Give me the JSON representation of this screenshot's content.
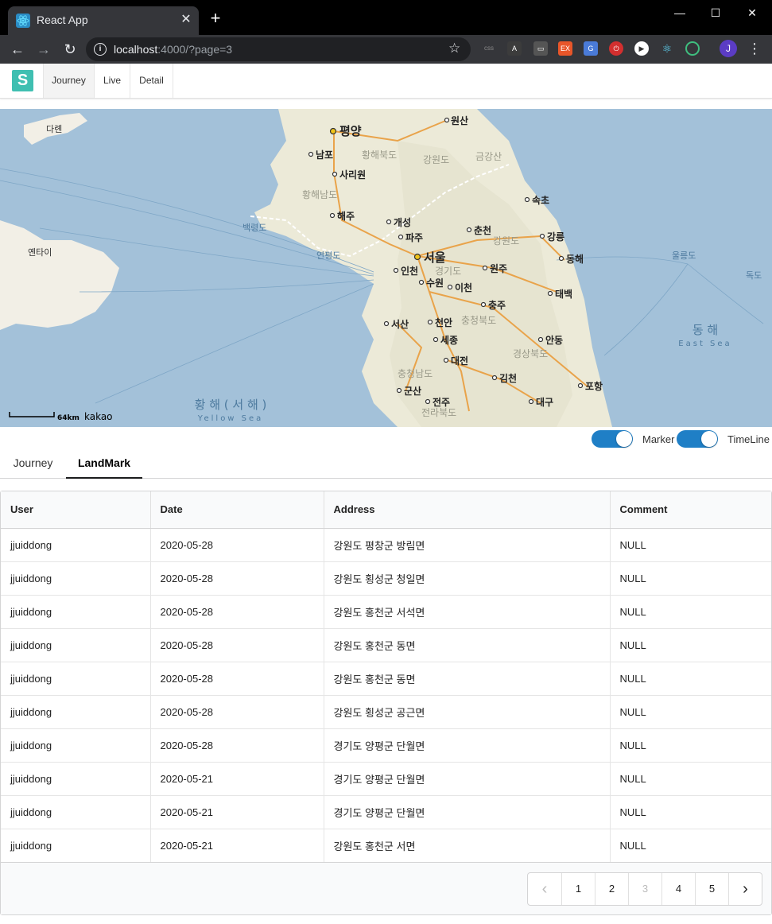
{
  "browser": {
    "tab_title": "React App",
    "tab_close": "✕",
    "new_tab": "+",
    "url_host": "localhost",
    "url_rest": ":4000/?page=3",
    "profile_initial": "J",
    "window_controls": [
      "—",
      "☐",
      "✕"
    ]
  },
  "app": {
    "logo": "S",
    "nav": [
      "Journey",
      "Live",
      "Detail"
    ],
    "active_nav": "Journey"
  },
  "map": {
    "scale_label": "64km",
    "provider": "kakao",
    "labels": {
      "pyongyang": "평양",
      "nampo": "남포",
      "sariwon": "사리원",
      "haeju": "해주",
      "kaesong": "개성",
      "paju": "파주",
      "seoul": "서울",
      "incheon": "인천",
      "suwon": "수원",
      "icheon": "이천",
      "chuncheon": "춘천",
      "wonju": "원주",
      "chungju": "충주",
      "cheonan": "천안",
      "sejong": "세종",
      "daejeon": "대전",
      "gimcheon": "김천",
      "daegu": "대구",
      "pohang": "포항",
      "andong": "안동",
      "gangneung": "강릉",
      "donghae": "동해",
      "sokcho": "속초",
      "taebaek": "태백",
      "seosan": "서산",
      "gunsan": "군산",
      "jeonju": "전주",
      "wonsan": "원산",
      "dalian": "다롄",
      "yantai": "옌타이",
      "yeonpyeongdo": "연평도",
      "baengnyeongdo": "백령도",
      "ulleungdo": "울릉도",
      "dokdo": "독도",
      "yellow_sea": "황 해 ( 서 해 )",
      "yellow_sea_en": "Yellow Sea",
      "east_sea": "동 해",
      "east_sea_en": "East Sea",
      "gangwon": "강원도",
      "gyeonggi": "경기도",
      "chungbuk": "충청북도",
      "chungnam": "충청남도",
      "gyeongbuk": "경상북도",
      "jeonbuk": "전라북도",
      "hwanghaebuk": "황해북도",
      "hwanghaenam": "황해남도",
      "gangwon_n": "강원도",
      "kumgangsan": "금강산"
    }
  },
  "toggles": [
    {
      "label": "Marker",
      "on": true
    },
    {
      "label": "TimeLine",
      "on": true
    }
  ],
  "tabs": [
    "Journey",
    "LandMark"
  ],
  "active_tab": "LandMark",
  "table": {
    "columns": [
      "User",
      "Date",
      "Address",
      "Comment"
    ],
    "rows": [
      [
        "jjuiddong",
        "2020-05-28",
        "강원도 평창군 방림면",
        "NULL"
      ],
      [
        "jjuiddong",
        "2020-05-28",
        "강원도 횡성군 청일면",
        "NULL"
      ],
      [
        "jjuiddong",
        "2020-05-28",
        "강원도 홍천군 서석면",
        "NULL"
      ],
      [
        "jjuiddong",
        "2020-05-28",
        "강원도 홍천군 동면",
        "NULL"
      ],
      [
        "jjuiddong",
        "2020-05-28",
        "강원도 홍천군 동면",
        "NULL"
      ],
      [
        "jjuiddong",
        "2020-05-28",
        "강원도 횡성군 공근면",
        "NULL"
      ],
      [
        "jjuiddong",
        "2020-05-28",
        "경기도 양평군 단월면",
        "NULL"
      ],
      [
        "jjuiddong",
        "2020-05-21",
        "경기도 양평군 단월면",
        "NULL"
      ],
      [
        "jjuiddong",
        "2020-05-21",
        "경기도 양평군 단월면",
        "NULL"
      ],
      [
        "jjuiddong",
        "2020-05-21",
        "강원도 홍천군 서면",
        "NULL"
      ]
    ]
  },
  "pagination": {
    "prev": "‹",
    "pages": [
      "1",
      "2",
      "3",
      "4",
      "5"
    ],
    "current": "3",
    "next": "›"
  }
}
